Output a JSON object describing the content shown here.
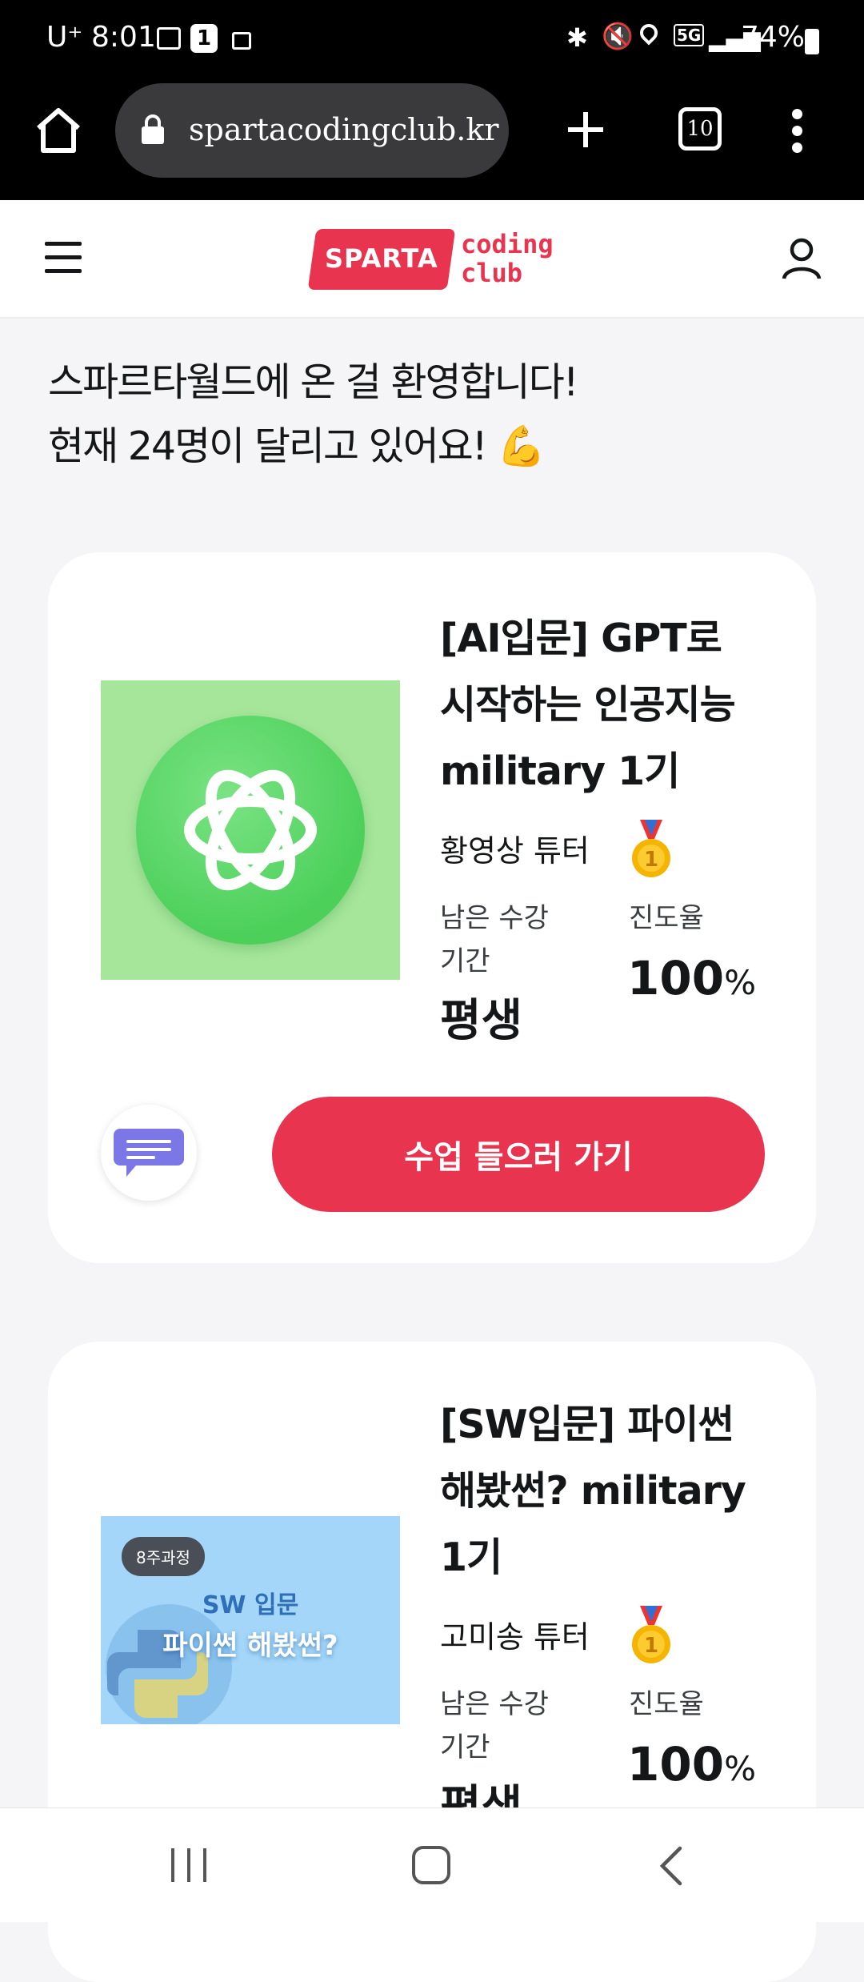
{
  "status_bar": {
    "carrier": "U⁺",
    "time": "8:01",
    "network": "5G",
    "battery": "74%"
  },
  "browser": {
    "url": "spartacodingclub.kr",
    "tab_count": "10"
  },
  "header": {
    "logo_main": "SPARTA",
    "logo_sub_1": "coding",
    "logo_sub_2": "club"
  },
  "welcome": {
    "line1": "스파르타월드에 온 걸 환영합니다!",
    "line2": "현재 24명이 달리고 있어요!",
    "emoji": "💪"
  },
  "courses": [
    {
      "title_lines": [
        "[AI입문] GPT로",
        "시작하는 인공지능",
        "military 1기"
      ],
      "tutor": "황영상 튜터",
      "remaining_label_1": "남은 수강",
      "remaining_label_2": "기간",
      "remaining_value": "평생",
      "progress_label": "진도율",
      "progress_value": "100",
      "progress_unit": "%",
      "button_label": "수업 들으러 가기",
      "colors": {
        "thumb_bg": "#A6E69A",
        "circle": "#4CD05A"
      }
    },
    {
      "title_lines": [
        "[SW입문] 파이썬",
        "해봤썬? military",
        "1기"
      ],
      "tutor": "고미송 튜터",
      "remaining_label_1": "남은 수강",
      "remaining_label_2": "기간",
      "remaining_value": "평생",
      "progress_label": "진도율",
      "progress_value": "100",
      "progress_unit": "%",
      "thumb_badge": "8주과정",
      "thumb_line1": "SW 입문",
      "thumb_line2": "파이썬 해봤썬?",
      "colors": {
        "thumb_bg": "#A3D6F8"
      }
    }
  ],
  "colors": {
    "accent": "#E8344E",
    "card_bg": "#FFFFFF",
    "page_bg": "#F5F5F7"
  }
}
